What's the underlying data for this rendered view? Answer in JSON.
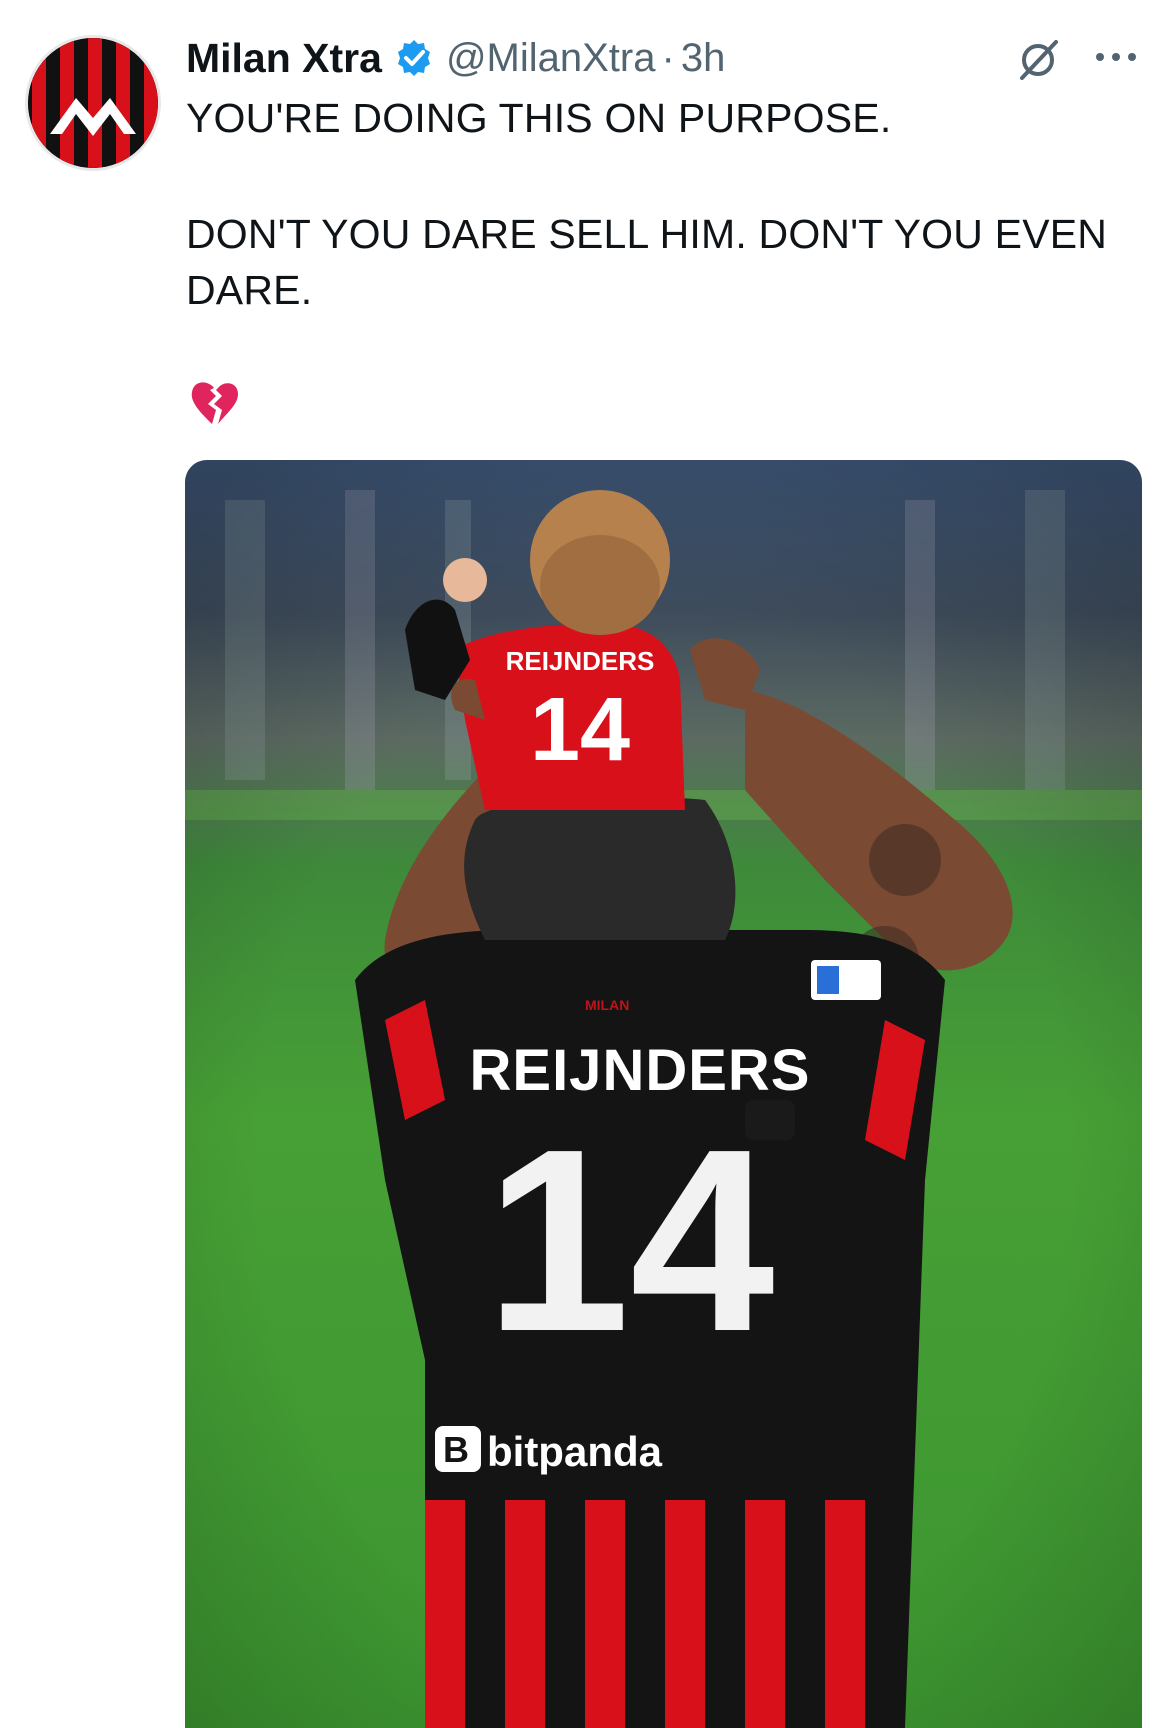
{
  "tweet": {
    "author": {
      "display_name": "Milan Xtra",
      "handle": "@MilanXtra",
      "separator": "·",
      "time": "3h"
    },
    "text_line_1": "YOU'RE DOING THIS ON PURPOSE.",
    "text_line_2": "DON'T YOU DARE SELL HIM. DON'T YOU EVEN DARE.",
    "emoji": "broken-heart",
    "icons": {
      "verified": "verified-badge-icon",
      "grok": "grok-icon",
      "more": "more-options-icon"
    }
  },
  "photo": {
    "jersey_name": "REIJNDERS",
    "jersey_number": "14",
    "child_jersey_name": "REIJNDERS",
    "child_jersey_number": "14",
    "sponsor": "bitpanda",
    "club_crest_text": "MILAN"
  },
  "colors": {
    "milan_red": "#d8101a",
    "milan_black": "#111111",
    "verified_blue": "#1d9bf0",
    "secondary_text": "#536471",
    "pitch_green": "#3f9a2e"
  }
}
